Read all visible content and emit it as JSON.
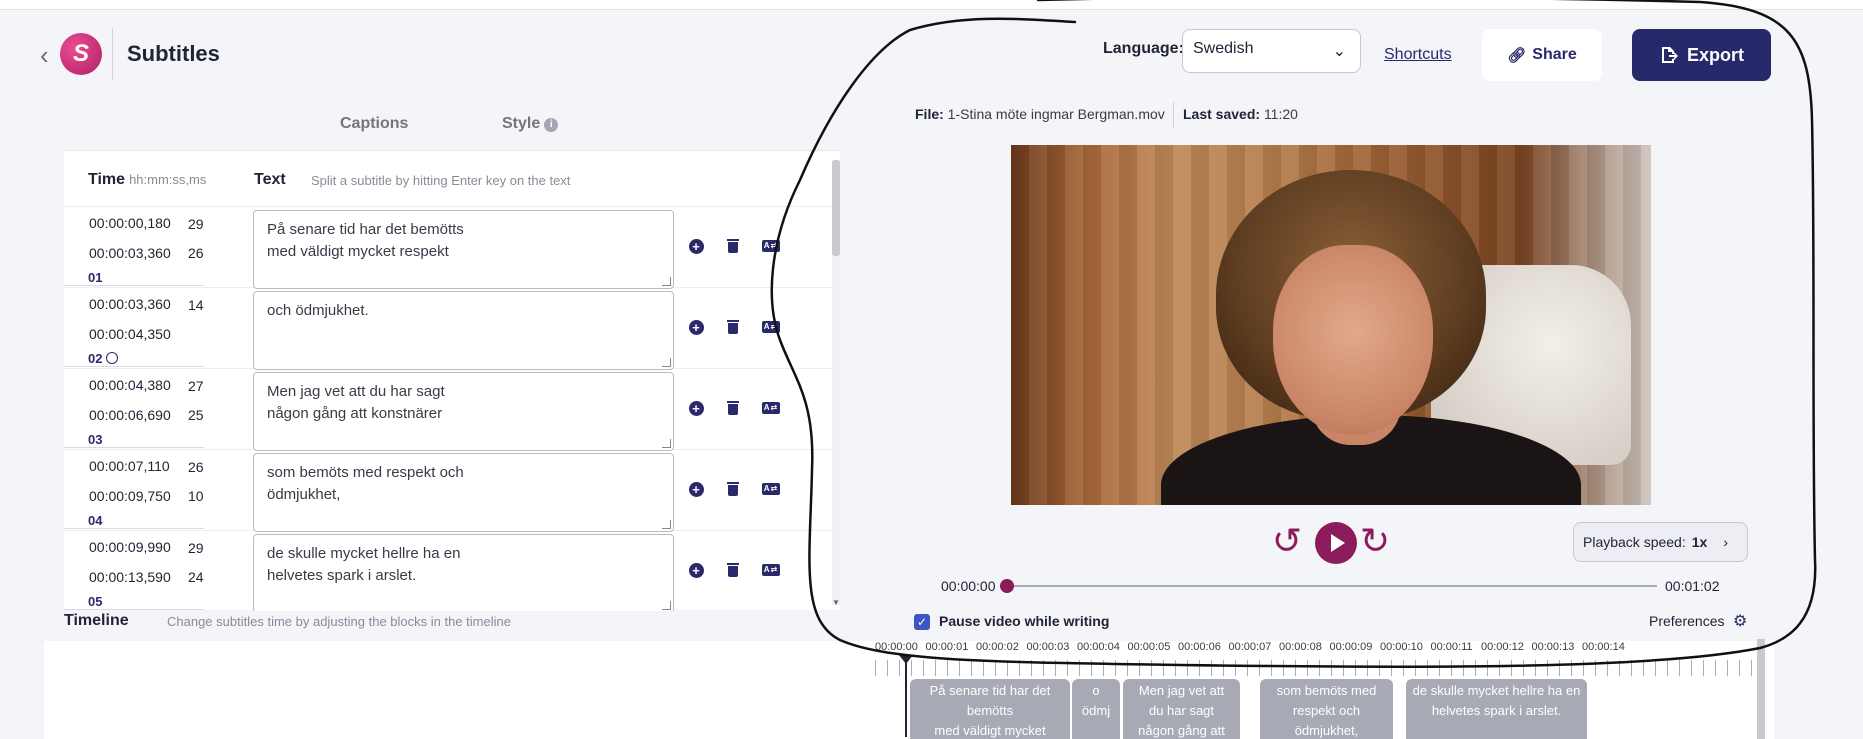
{
  "header": {
    "back_glyph": "‹",
    "logo_text": "S",
    "title": "Subtitles",
    "language_label": "Language:",
    "language_value": "Swedish",
    "shortcuts_label": "Shortcuts",
    "share_label": "Share",
    "export_label": "Export"
  },
  "tabs": [
    {
      "label": "Captions"
    },
    {
      "label": "Style"
    }
  ],
  "subtitle_table": {
    "time_header": "Time",
    "time_format": "hh:mm:ss,ms",
    "text_header": "Text",
    "text_hint": "Split a subtitle by hitting Enter key on the text",
    "rows": [
      {
        "start": "00:00:00,180",
        "end": "00:00:03,360",
        "cps1": "29",
        "cps2": "26",
        "num": "01",
        "text": "På senare tid har det bemötts\nmed väldigt mycket respekt"
      },
      {
        "start": "00:00:03,360",
        "end": "00:00:04,350",
        "cps1": "14",
        "cps2": "",
        "num": "02",
        "text": "och ödmjukhet."
      },
      {
        "start": "00:00:04,380",
        "end": "00:00:06,690",
        "cps1": "27",
        "cps2": "25",
        "num": "03",
        "text": "Men jag vet att du har sagt\nnågon gång att konstnärer"
      },
      {
        "start": "00:00:07,110",
        "end": "00:00:09,750",
        "cps1": "26",
        "cps2": "10",
        "num": "04",
        "text": "som bemöts med respekt och\nödmjukhet,"
      },
      {
        "start": "00:00:09,990",
        "end": "00:00:13,590",
        "cps1": "29",
        "cps2": "24",
        "num": "05",
        "text": "de skulle mycket hellre ha en\nhelvetes spark i arslet."
      }
    ]
  },
  "timeline": {
    "label": "Timeline",
    "hint": "Change subtitles time by adjusting the blocks in the timeline",
    "tick_labels": [
      "00:00:00",
      "00:00:01",
      "00:00:02",
      "00:00:03",
      "00:00:04",
      "00:00:05",
      "00:00:06",
      "00:00:07",
      "00:00:08",
      "00:00:09",
      "00:00:10",
      "00:00:11",
      "00:00:12",
      "00:00:13",
      "00:00:14"
    ],
    "clips": [
      {
        "text": "På senare tid har det\nbemötts\nmed väldigt mycket"
      },
      {
        "text": "o\nödmj"
      },
      {
        "text": "Men jag vet att\ndu har sagt\nnågon gång att"
      },
      {
        "text": "som bemöts med\nrespekt och\nödmjukhet,"
      },
      {
        "text": "de skulle mycket hellre ha en\nhelvetes spark i arslet."
      }
    ]
  },
  "player": {
    "file_label": "File:",
    "file_name": "1-Stina möte ingmar Bergman.mov",
    "last_saved_label": "Last saved:",
    "last_saved_value": "11:20",
    "current_time": "00:00:00",
    "total_time": "00:01:02",
    "progress": 0,
    "speed_label": "Playback speed:",
    "speed_value": "1x",
    "pause_label": "Pause video while writing",
    "pause_checked": true,
    "preferences_label": "Preferences"
  },
  "colors": {
    "brand_navy": "#262a6b",
    "brand_magenta": "#8c1b5c",
    "clip_gray": "#a7a9b4"
  }
}
